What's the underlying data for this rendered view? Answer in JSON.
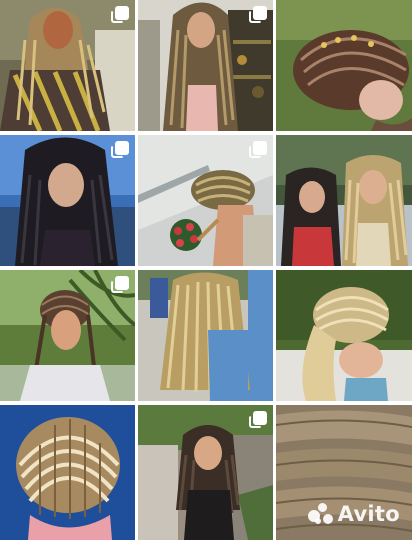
{
  "gallery": {
    "tiles": [
      {
        "id": 1,
        "subject": "woman-blonde-box-braids-striped-shirt",
        "multi": true
      },
      {
        "id": 2,
        "subject": "woman-box-braids-shop-shelves",
        "multi": true
      },
      {
        "id": 3,
        "subject": "cornrows-with-beads-side-view",
        "multi": false
      },
      {
        "id": 4,
        "subject": "woman-black-box-braids-seaside",
        "multi": true
      },
      {
        "id": 5,
        "subject": "blonde-cornrows-watering-flowers",
        "multi": true
      },
      {
        "id": 6,
        "subject": "two-women-with-braids",
        "multi": false
      },
      {
        "id": 7,
        "subject": "cornrows-under-palm-tree",
        "multi": true
      },
      {
        "id": 8,
        "subject": "blonde-box-braids-back-view",
        "multi": false
      },
      {
        "id": 9,
        "subject": "blonde-cornrows-top-view",
        "multi": false
      },
      {
        "id": 10,
        "subject": "cornrows-top-view-closeup",
        "multi": false
      },
      {
        "id": 11,
        "subject": "woman-braids-on-stone-path",
        "multi": true
      },
      {
        "id": 12,
        "subject": "braid-bundle-texture",
        "multi": false
      }
    ]
  },
  "watermark": {
    "text": "Avito"
  },
  "colors": {
    "multi_icon": "#ffffff",
    "background": "#ffffff"
  }
}
